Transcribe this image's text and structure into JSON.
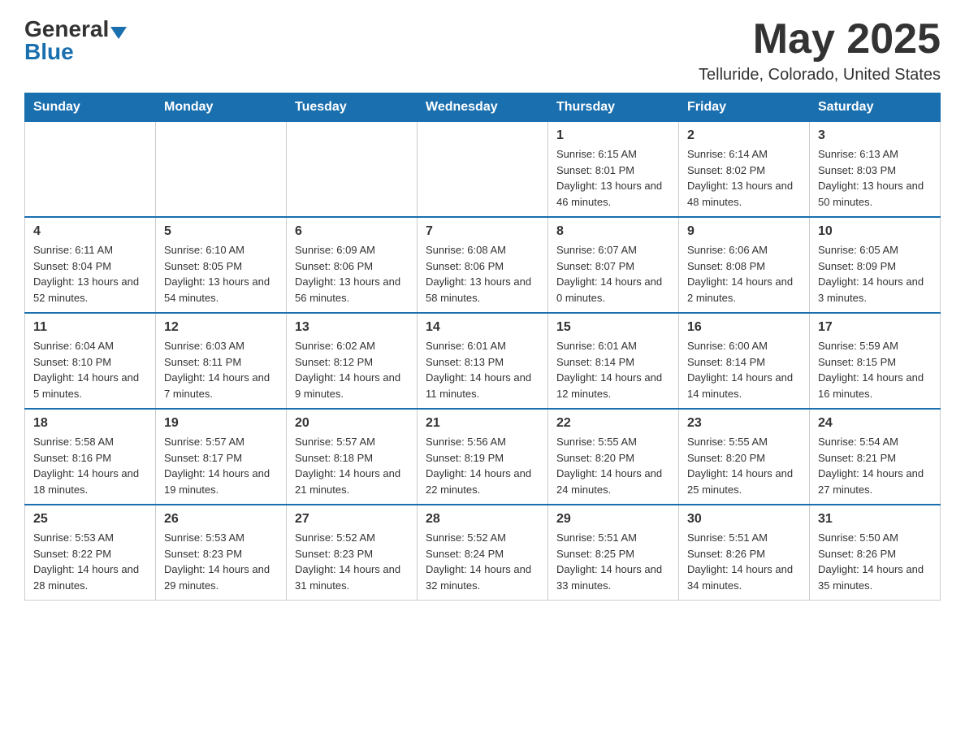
{
  "header": {
    "logo_general": "General",
    "logo_blue": "Blue",
    "month_year": "May 2025",
    "location": "Telluride, Colorado, United States"
  },
  "days_of_week": [
    "Sunday",
    "Monday",
    "Tuesday",
    "Wednesday",
    "Thursday",
    "Friday",
    "Saturday"
  ],
  "weeks": [
    [
      {
        "day": "",
        "info": ""
      },
      {
        "day": "",
        "info": ""
      },
      {
        "day": "",
        "info": ""
      },
      {
        "day": "",
        "info": ""
      },
      {
        "day": "1",
        "info": "Sunrise: 6:15 AM\nSunset: 8:01 PM\nDaylight: 13 hours and 46 minutes."
      },
      {
        "day": "2",
        "info": "Sunrise: 6:14 AM\nSunset: 8:02 PM\nDaylight: 13 hours and 48 minutes."
      },
      {
        "day": "3",
        "info": "Sunrise: 6:13 AM\nSunset: 8:03 PM\nDaylight: 13 hours and 50 minutes."
      }
    ],
    [
      {
        "day": "4",
        "info": "Sunrise: 6:11 AM\nSunset: 8:04 PM\nDaylight: 13 hours and 52 minutes."
      },
      {
        "day": "5",
        "info": "Sunrise: 6:10 AM\nSunset: 8:05 PM\nDaylight: 13 hours and 54 minutes."
      },
      {
        "day": "6",
        "info": "Sunrise: 6:09 AM\nSunset: 8:06 PM\nDaylight: 13 hours and 56 minutes."
      },
      {
        "day": "7",
        "info": "Sunrise: 6:08 AM\nSunset: 8:06 PM\nDaylight: 13 hours and 58 minutes."
      },
      {
        "day": "8",
        "info": "Sunrise: 6:07 AM\nSunset: 8:07 PM\nDaylight: 14 hours and 0 minutes."
      },
      {
        "day": "9",
        "info": "Sunrise: 6:06 AM\nSunset: 8:08 PM\nDaylight: 14 hours and 2 minutes."
      },
      {
        "day": "10",
        "info": "Sunrise: 6:05 AM\nSunset: 8:09 PM\nDaylight: 14 hours and 3 minutes."
      }
    ],
    [
      {
        "day": "11",
        "info": "Sunrise: 6:04 AM\nSunset: 8:10 PM\nDaylight: 14 hours and 5 minutes."
      },
      {
        "day": "12",
        "info": "Sunrise: 6:03 AM\nSunset: 8:11 PM\nDaylight: 14 hours and 7 minutes."
      },
      {
        "day": "13",
        "info": "Sunrise: 6:02 AM\nSunset: 8:12 PM\nDaylight: 14 hours and 9 minutes."
      },
      {
        "day": "14",
        "info": "Sunrise: 6:01 AM\nSunset: 8:13 PM\nDaylight: 14 hours and 11 minutes."
      },
      {
        "day": "15",
        "info": "Sunrise: 6:01 AM\nSunset: 8:14 PM\nDaylight: 14 hours and 12 minutes."
      },
      {
        "day": "16",
        "info": "Sunrise: 6:00 AM\nSunset: 8:14 PM\nDaylight: 14 hours and 14 minutes."
      },
      {
        "day": "17",
        "info": "Sunrise: 5:59 AM\nSunset: 8:15 PM\nDaylight: 14 hours and 16 minutes."
      }
    ],
    [
      {
        "day": "18",
        "info": "Sunrise: 5:58 AM\nSunset: 8:16 PM\nDaylight: 14 hours and 18 minutes."
      },
      {
        "day": "19",
        "info": "Sunrise: 5:57 AM\nSunset: 8:17 PM\nDaylight: 14 hours and 19 minutes."
      },
      {
        "day": "20",
        "info": "Sunrise: 5:57 AM\nSunset: 8:18 PM\nDaylight: 14 hours and 21 minutes."
      },
      {
        "day": "21",
        "info": "Sunrise: 5:56 AM\nSunset: 8:19 PM\nDaylight: 14 hours and 22 minutes."
      },
      {
        "day": "22",
        "info": "Sunrise: 5:55 AM\nSunset: 8:20 PM\nDaylight: 14 hours and 24 minutes."
      },
      {
        "day": "23",
        "info": "Sunrise: 5:55 AM\nSunset: 8:20 PM\nDaylight: 14 hours and 25 minutes."
      },
      {
        "day": "24",
        "info": "Sunrise: 5:54 AM\nSunset: 8:21 PM\nDaylight: 14 hours and 27 minutes."
      }
    ],
    [
      {
        "day": "25",
        "info": "Sunrise: 5:53 AM\nSunset: 8:22 PM\nDaylight: 14 hours and 28 minutes."
      },
      {
        "day": "26",
        "info": "Sunrise: 5:53 AM\nSunset: 8:23 PM\nDaylight: 14 hours and 29 minutes."
      },
      {
        "day": "27",
        "info": "Sunrise: 5:52 AM\nSunset: 8:23 PM\nDaylight: 14 hours and 31 minutes."
      },
      {
        "day": "28",
        "info": "Sunrise: 5:52 AM\nSunset: 8:24 PM\nDaylight: 14 hours and 32 minutes."
      },
      {
        "day": "29",
        "info": "Sunrise: 5:51 AM\nSunset: 8:25 PM\nDaylight: 14 hours and 33 minutes."
      },
      {
        "day": "30",
        "info": "Sunrise: 5:51 AM\nSunset: 8:26 PM\nDaylight: 14 hours and 34 minutes."
      },
      {
        "day": "31",
        "info": "Sunrise: 5:50 AM\nSunset: 8:26 PM\nDaylight: 14 hours and 35 minutes."
      }
    ]
  ]
}
